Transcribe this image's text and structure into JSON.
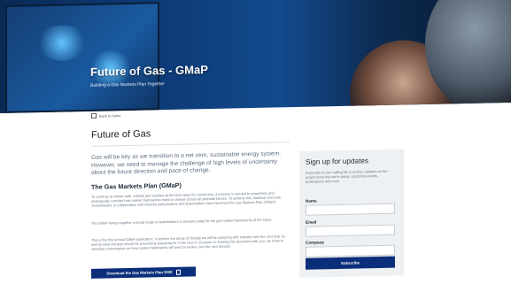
{
  "hero": {
    "title": "Future of Gas - GMaP",
    "subtitle": "Building a Gas Markets Plan Together"
  },
  "breadcrumb": {
    "label": "Back to home"
  },
  "page_title": "Future of Gas",
  "intro": "Gas will be key as we transition to a net zero, sustainable energy system. However, we need to manage the challenge of high levels of uncertainty about the future direction and pace of change.",
  "section_heading": "The Gas Markets Plan (GMaP)",
  "paragraphs": [
    "To continue to deliver safe, reliable gas supplies at the best value for consumers, a process is needed to proactively and strategically consider how market frameworks need to change across all potential futures. To achieve this, National Grid Gas Transmission, in collaboration with industry policymakers and stakeholders have launched the Gas Markets Plan (GMaP).",
    "The GMaP brings together a broad range of stakeholders to prepare today for the gas market frameworks of the future.",
    "This is the first annual GMaP publication. It outlines the areas of change we will be exploring with industry over the next year as well as what industry should be proactively preparing for in the next 5–10 years. In sharing this document with you, we hope to stimulate conversation on how market frameworks will need to evolve over the next decade."
  ],
  "download": {
    "label": "Download the Gas Markets Plan 2020",
    "icon": "document-icon"
  },
  "signup": {
    "title": "Sign up for updates",
    "description": "Subscribe to our mailing list to receive updates on the project work that we're doing, upcoming events, publications and more.",
    "name_label": "Name",
    "email_label": "Email",
    "company_label": "Company",
    "submit_label": "Subscribe"
  },
  "colors": {
    "accent": "#0b2e7a",
    "card_bg": "#eef1f4",
    "hero_bg": "#0e3d7a"
  }
}
